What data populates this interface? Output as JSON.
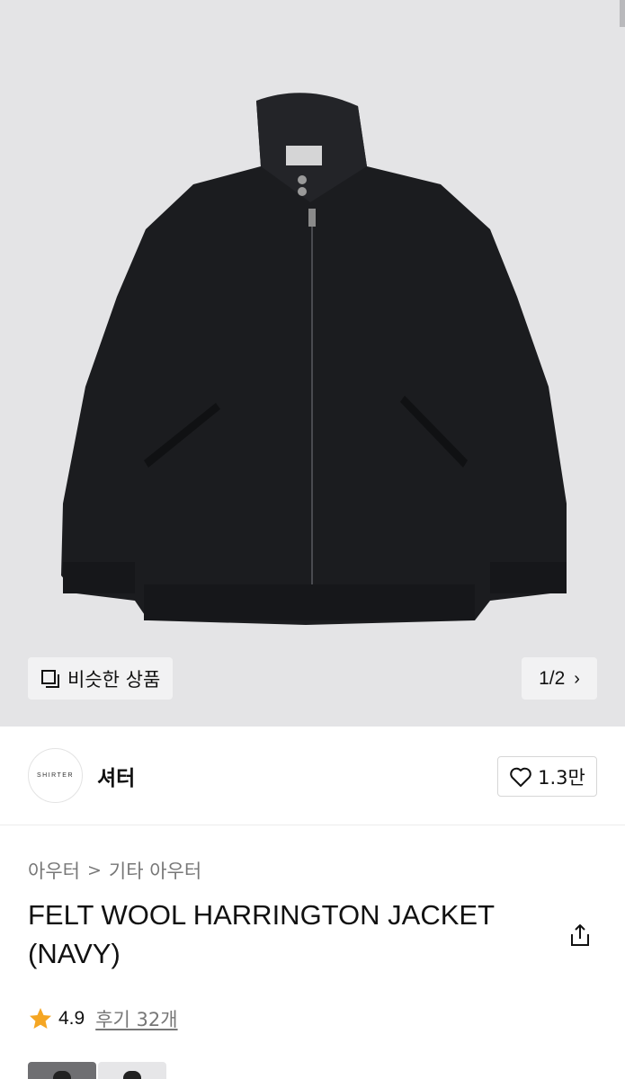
{
  "gallery": {
    "similar_label": "비슷한 상품",
    "page_indicator": "1/2",
    "chevron": "›"
  },
  "brand": {
    "logo_text": "SHIRTER",
    "name": "셔터",
    "like_count": "1.3만"
  },
  "product": {
    "breadcrumb": [
      "아우터",
      "기타 아우터"
    ],
    "breadcrumb_separator": ">",
    "title": "FELT WOOL HARRINGTON JACKET (NAVY)",
    "rating": "4.9",
    "reviews": "후기 32개"
  },
  "colors": {
    "star": "#f5a623",
    "image_bg": "#e4e4e6"
  },
  "icons": [
    "similar-items-icon",
    "chevron-right-icon",
    "heart-icon",
    "share-icon",
    "star-icon"
  ]
}
